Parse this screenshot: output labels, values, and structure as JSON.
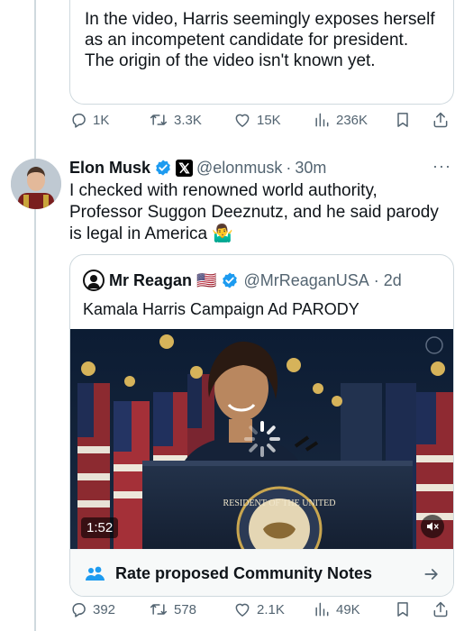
{
  "prev_tweet": {
    "quoted_text": "In the video, Harris seemingly exposes herself as an incompetent candidate for president. The origin of the video isn't known yet.",
    "replies": "1K",
    "reposts": "3.3K",
    "likes": "15K",
    "views": "236K"
  },
  "tweet": {
    "author_name": "Elon Musk",
    "handle": "@elonmusk",
    "separator": "·",
    "time": "30m",
    "more": "···",
    "text": "I checked with renowned world authority, Professor Suggon Deeznutz, and he said parody is legal in America",
    "emoji": "🤷‍♂️",
    "replies": "392",
    "reposts": "578",
    "likes": "2.1K",
    "views": "49K"
  },
  "quote": {
    "author_name": "Mr Reagan",
    "flag": "🇺🇸",
    "handle": "@MrReaganUSA",
    "separator": "·",
    "time": "2d",
    "text": "Kamala Harris Campaign Ad PARODY",
    "video_duration": "1:52",
    "podium_seal_text": "RESIDENT OF THE UNITED"
  },
  "community_notes": {
    "label": "Rate proposed Community Notes"
  },
  "colors": {
    "accent": "#1d9bf0",
    "muted": "#536471",
    "border": "#cfd9de"
  },
  "icons": [
    "reply-icon",
    "repost-icon",
    "like-icon",
    "views-icon",
    "bookmark-icon",
    "share-icon",
    "verified-badge-icon",
    "x-affiliate-icon",
    "more-icon",
    "people-icon",
    "arrow-right-icon",
    "mute-icon",
    "loading-spinner-icon"
  ]
}
